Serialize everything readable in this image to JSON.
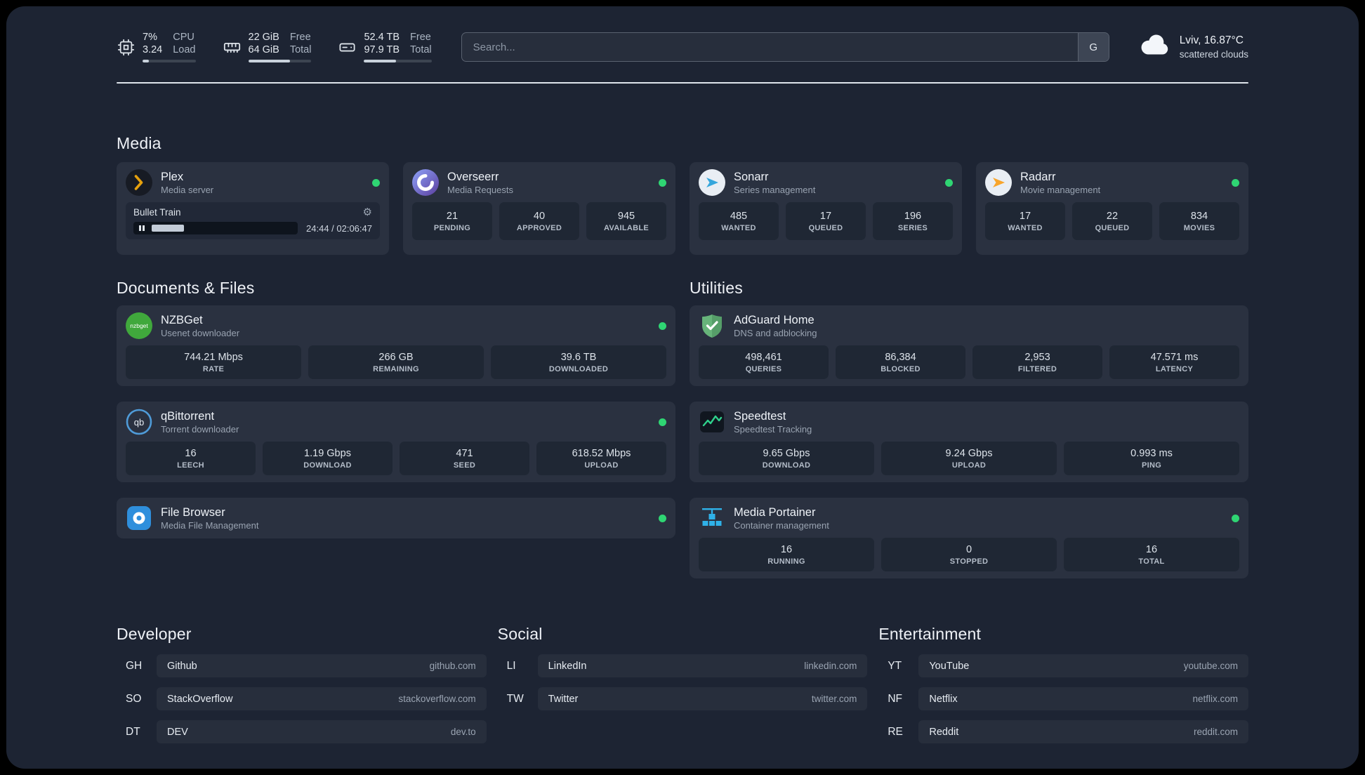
{
  "topbar": {
    "widgets": [
      {
        "v1": "7%",
        "v2": "3.24",
        "l1": "CPU",
        "l2": "Load",
        "progress": 12
      },
      {
        "v1": "22 GiB",
        "v2": "64 GiB",
        "l1": "Free",
        "l2": "Total",
        "progress": 66
      },
      {
        "v1": "52.4 TB",
        "v2": "97.9 TB",
        "l1": "Free",
        "l2": "Total",
        "progress": 47
      }
    ],
    "search": {
      "placeholder": "Search...",
      "provider": "G"
    },
    "weather": {
      "location": "Lviv, 16.87°C",
      "condition": "scattered clouds"
    }
  },
  "media": {
    "title": "Media",
    "plex": {
      "name": "Plex",
      "desc": "Media server",
      "player": {
        "title": "Bullet Train",
        "time": "24:44 / 02:06:47",
        "progress": 19.5
      }
    },
    "overseerr": {
      "name": "Overseerr",
      "desc": "Media Requests",
      "stats": [
        {
          "v": "21",
          "l": "PENDING"
        },
        {
          "v": "40",
          "l": "APPROVED"
        },
        {
          "v": "945",
          "l": "AVAILABLE"
        }
      ]
    },
    "sonarr": {
      "name": "Sonarr",
      "desc": "Series management",
      "stats": [
        {
          "v": "485",
          "l": "WANTED"
        },
        {
          "v": "17",
          "l": "QUEUED"
        },
        {
          "v": "196",
          "l": "SERIES"
        }
      ]
    },
    "radarr": {
      "name": "Radarr",
      "desc": "Movie management",
      "stats": [
        {
          "v": "17",
          "l": "WANTED"
        },
        {
          "v": "22",
          "l": "QUEUED"
        },
        {
          "v": "834",
          "l": "MOVIES"
        }
      ]
    }
  },
  "documents": {
    "title": "Documents & Files",
    "nzbget": {
      "name": "NZBGet",
      "desc": "Usenet downloader",
      "icon_text": "nzbget",
      "stats": [
        {
          "v": "744.21 Mbps",
          "l": "RATE"
        },
        {
          "v": "266 GB",
          "l": "REMAINING"
        },
        {
          "v": "39.6 TB",
          "l": "DOWNLOADED"
        }
      ]
    },
    "qbittorrent": {
      "name": "qBittorrent",
      "desc": "Torrent downloader",
      "icon_text": "qb",
      "stats": [
        {
          "v": "16",
          "l": "LEECH"
        },
        {
          "v": "1.19 Gbps",
          "l": "DOWNLOAD"
        },
        {
          "v": "471",
          "l": "SEED"
        },
        {
          "v": "618.52 Mbps",
          "l": "UPLOAD"
        }
      ]
    },
    "filebrowser": {
      "name": "File Browser",
      "desc": "Media File Management"
    }
  },
  "utilities": {
    "title": "Utilities",
    "adguard": {
      "name": "AdGuard Home",
      "desc": "DNS and adblocking",
      "stats": [
        {
          "v": "498,461",
          "l": "QUERIES"
        },
        {
          "v": "86,384",
          "l": "BLOCKED"
        },
        {
          "v": "2,953",
          "l": "FILTERED"
        },
        {
          "v": "47.571 ms",
          "l": "LATENCY"
        }
      ]
    },
    "speedtest": {
      "name": "Speedtest",
      "desc": "Speedtest Tracking",
      "stats": [
        {
          "v": "9.65 Gbps",
          "l": "DOWNLOAD"
        },
        {
          "v": "9.24 Gbps",
          "l": "UPLOAD"
        },
        {
          "v": "0.993 ms",
          "l": "PING"
        }
      ]
    },
    "portainer": {
      "name": "Media Portainer",
      "desc": "Container management",
      "stats": [
        {
          "v": "16",
          "l": "RUNNING"
        },
        {
          "v": "0",
          "l": "STOPPED"
        },
        {
          "v": "16",
          "l": "TOTAL"
        }
      ]
    }
  },
  "bookmarks": [
    {
      "title": "Developer",
      "items": [
        {
          "abbr": "GH",
          "name": "Github",
          "url": "github.com"
        },
        {
          "abbr": "SO",
          "name": "StackOverflow",
          "url": "stackoverflow.com"
        },
        {
          "abbr": "DT",
          "name": "DEV",
          "url": "dev.to"
        }
      ]
    },
    {
      "title": "Social",
      "items": [
        {
          "abbr": "LI",
          "name": "LinkedIn",
          "url": "linkedin.com"
        },
        {
          "abbr": "TW",
          "name": "Twitter",
          "url": "twitter.com"
        }
      ]
    },
    {
      "title": "Entertainment",
      "items": [
        {
          "abbr": "YT",
          "name": "YouTube",
          "url": "youtube.com"
        },
        {
          "abbr": "NF",
          "name": "Netflix",
          "url": "netflix.com"
        },
        {
          "abbr": "RE",
          "name": "Reddit",
          "url": "reddit.com"
        }
      ]
    }
  ],
  "colors": {
    "status_online": "#2fd573",
    "plex_amber": "#e5a00d",
    "sonarr_blue": "#35a6dc",
    "radarr_amber": "#f8a52b",
    "nzbget_green": "#40a83c",
    "adguard_green": "#67b47a",
    "qbittorrent_blue": "#4f9bd8",
    "speedtest_green": "#2fd08c",
    "filebrowser_blue": "#2f8fdc",
    "portainer_blue": "#2fb1e8",
    "overseerr_purple": "#6e5bd0"
  }
}
